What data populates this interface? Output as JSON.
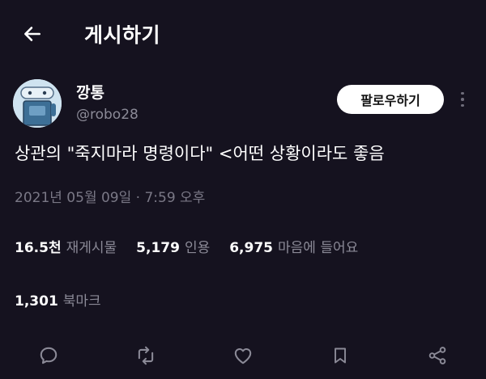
{
  "header": {
    "title": "게시하기",
    "back_icon": "arrow-left-icon"
  },
  "author": {
    "name": "깡통",
    "handle": "@robo28",
    "follow_label": "팔로우하기"
  },
  "post": {
    "text": "상관의 \"죽지마라 명령이다\" <어떤 상황이라도 좋음",
    "timestamp": "2021년 05월 09일 · 7:59 오후"
  },
  "stats": {
    "reposts_count": "16.5천",
    "reposts_label": "재게시물",
    "quotes_count": "5,179",
    "quotes_label": "인용",
    "likes_count": "6,975",
    "likes_label": "마음에 들어요",
    "bookmarks_count": "1,301",
    "bookmarks_label": "북마크"
  },
  "actions": [
    "reply-icon",
    "repost-icon",
    "heart-icon",
    "bookmark-icon",
    "share-icon"
  ],
  "colors": {
    "background": "#15121f",
    "text": "#ffffff",
    "muted": "#8b8a97",
    "follow_bg": "#ffffff"
  }
}
